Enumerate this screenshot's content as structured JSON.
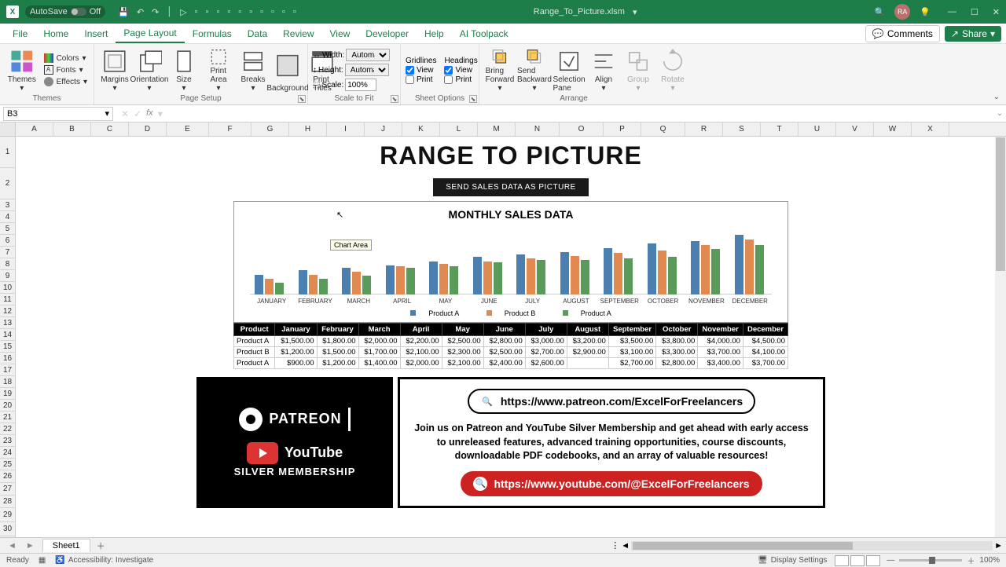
{
  "titlebar": {
    "autosave": "AutoSave",
    "autosave_state": "Off",
    "docname": "Range_To_Picture.xlsm",
    "avatar": "RA"
  },
  "menu": {
    "file": "File",
    "home": "Home",
    "insert": "Insert",
    "page_layout": "Page Layout",
    "formulas": "Formulas",
    "data": "Data",
    "review": "Review",
    "view": "View",
    "developer": "Developer",
    "help": "Help",
    "ai": "AI Toolpack",
    "comments": "Comments",
    "share": "Share"
  },
  "ribbon": {
    "themes": {
      "label": "Themes",
      "main": "Themes",
      "colors": "Colors",
      "fonts": "Fonts",
      "effects": "Effects"
    },
    "page_setup": {
      "label": "Page Setup",
      "margins": "Margins",
      "orientation": "Orientation",
      "size": "Size",
      "print_area": "Print\nArea",
      "breaks": "Breaks",
      "background": "Background",
      "print_titles": "Print\nTitles"
    },
    "scale": {
      "label": "Scale to Fit",
      "width": "Width:",
      "height": "Height:",
      "scale": "Scale:",
      "auto": "Automatic",
      "pct": "100%"
    },
    "sheet_options": {
      "label": "Sheet Options",
      "gridlines": "Gridlines",
      "headings": "Headings",
      "view": "View",
      "print": "Print"
    },
    "arrange": {
      "label": "Arrange",
      "forward": "Bring\nForward",
      "backward": "Send\nBackward",
      "selection": "Selection\nPane",
      "align": "Align",
      "group": "Group",
      "rotate": "Rotate"
    }
  },
  "formula": {
    "cell": "B3",
    "fx": "fx"
  },
  "columns": [
    "A",
    "B",
    "C",
    "D",
    "E",
    "F",
    "G",
    "H",
    "I",
    "J",
    "K",
    "L",
    "M",
    "N",
    "O",
    "P",
    "Q",
    "R",
    "S",
    "T",
    "U",
    "V",
    "W",
    "X"
  ],
  "sheet": {
    "title": "RANGE TO PICTURE",
    "button": "SEND SALES DATA AS PICTURE",
    "chart_title": "MONTHLY SALES DATA",
    "chart_tag": "Chart Area",
    "months_short": [
      "JANUARY",
      "FEBRUARY",
      "MARCH",
      "APRIL",
      "MAY",
      "JUNE",
      "JULY",
      "AUGUST",
      "SEPTEMBER",
      "OCTOBER",
      "NOVEMBER",
      "DECEMBER"
    ],
    "legend": [
      "Product A",
      "Product B",
      "Product A"
    ],
    "table_header": [
      "Product",
      "January",
      "February",
      "March",
      "April",
      "May",
      "June",
      "July",
      "August",
      "September",
      "October",
      "November",
      "December"
    ],
    "rows": [
      [
        "Product A",
        "$1,500.00",
        "$1,800.00",
        "$2,000.00",
        "$2,200.00",
        "$2,500.00",
        "$2,800.00",
        "$3,000.00",
        "$3,200.00",
        "$3,500.00",
        "$3,800.00",
        "$4,000.00",
        "$4,500.00"
      ],
      [
        "Product B",
        "$1,200.00",
        "$1,500.00",
        "$1,700.00",
        "$2,100.00",
        "$2,300.00",
        "$2,500.00",
        "$2,700.00",
        "$2,900.00",
        "$3,100.00",
        "$3,300.00",
        "$3,700.00",
        "$4,100.00"
      ],
      [
        "Product A",
        "$900.00",
        "$1,200.00",
        "$1,400.00",
        "$2,000.00",
        "$2,100.00",
        "$2,400.00",
        "$2,600.00",
        "",
        "$2,700.00",
        "$2,800.00",
        "$3,400.00",
        "$3,700.00"
      ]
    ]
  },
  "chart_data": {
    "type": "bar",
    "title": "MONTHLY SALES DATA",
    "categories": [
      "January",
      "February",
      "March",
      "April",
      "May",
      "June",
      "July",
      "August",
      "September",
      "October",
      "November",
      "December"
    ],
    "series": [
      {
        "name": "Product A",
        "values": [
          1500,
          1800,
          2000,
          2200,
          2500,
          2800,
          3000,
          3200,
          3500,
          3800,
          4000,
          4500
        ]
      },
      {
        "name": "Product B",
        "values": [
          1200,
          1500,
          1700,
          2100,
          2300,
          2500,
          2700,
          2900,
          3100,
          3300,
          3700,
          4100
        ]
      },
      {
        "name": "Product A",
        "values": [
          900,
          1200,
          1400,
          2000,
          2100,
          2400,
          2600,
          2600,
          2700,
          2800,
          3400,
          3700
        ]
      }
    ],
    "ylim": [
      0,
      5000
    ],
    "xlabel": "",
    "ylabel": ""
  },
  "promo": {
    "patreon": "PATREON",
    "youtube": "YouTube",
    "silver": "SILVER MEMBERSHIP",
    "url1": "https://www.patreon.com/ExcelForFreelancers",
    "url2": "https://www.youtube.com/@ExcelForFreelancers",
    "text": "Join us on Patreon and YouTube Silver Membership and get ahead with early access to unreleased features, advanced training opportunities, course discounts, downloadable PDF codebooks, and an array of valuable resources!"
  },
  "tabs": {
    "sheet1": "Sheet1"
  },
  "status": {
    "ready": "Ready",
    "access": "Accessibility: Investigate",
    "display": "Display Settings",
    "zoom": "100%"
  }
}
